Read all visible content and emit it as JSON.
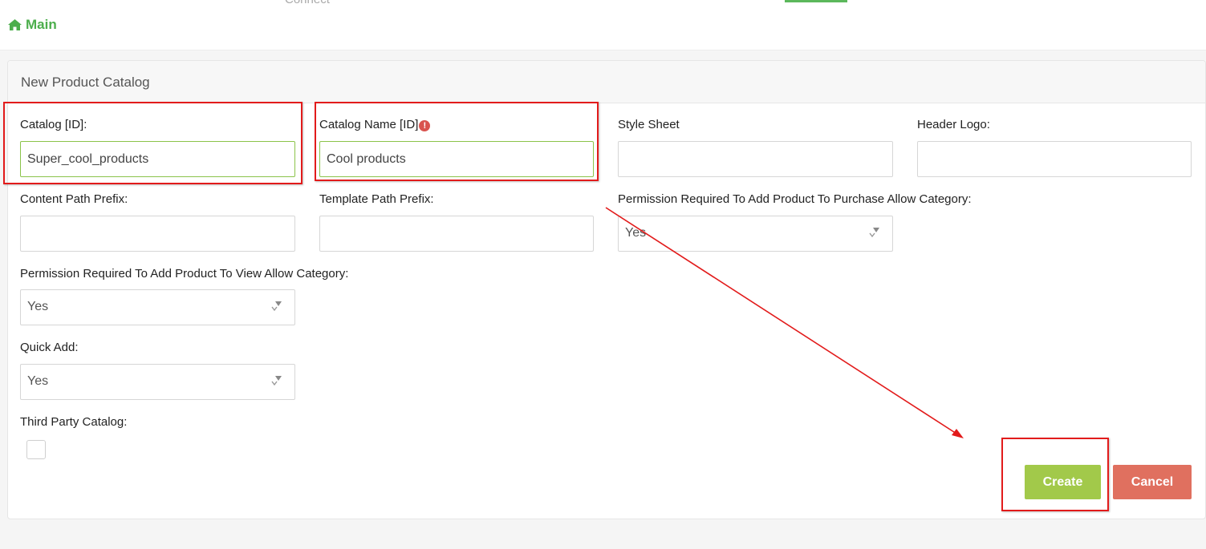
{
  "topnav": {
    "cut_tab_label": "Connect"
  },
  "breadcrumb": {
    "label": "Main"
  },
  "panel": {
    "title": "New Product Catalog"
  },
  "form": {
    "catalog_id": {
      "label": "Catalog [ID]:",
      "value": "Super_cool_products"
    },
    "catalog_name": {
      "label": "Catalog Name [ID]",
      "value": "Cool products",
      "error_glyph": "!"
    },
    "style_sheet": {
      "label": "Style Sheet",
      "value": ""
    },
    "header_logo": {
      "label": "Header Logo:",
      "value": ""
    },
    "content_path_prefix": {
      "label": "Content Path Prefix:",
      "value": ""
    },
    "template_path_prefix": {
      "label": "Template Path Prefix:",
      "value": ""
    },
    "perm_purchase": {
      "label": "Permission Required To Add Product To Purchase Allow Category:",
      "value": "Yes"
    },
    "perm_view": {
      "label": "Permission Required To Add Product To View Allow Category:",
      "value": "Yes"
    },
    "quick_add": {
      "label": "Quick Add:",
      "value": "Yes"
    },
    "third_party": {
      "label": "Third Party Catalog:",
      "checked": false
    }
  },
  "buttons": {
    "create_label": "Create",
    "cancel_label": "Cancel"
  },
  "colors": {
    "accent_green": "#4cae4c",
    "create_button": "#a2c94a",
    "cancel_button": "#e0705f",
    "annotation_red": "#e21b1b",
    "error_red": "#d9534f"
  },
  "icons": {
    "breadcrumb": "home-icon",
    "select_arrow": "sort-arrow-icon",
    "error": "exclamation-circle-icon"
  }
}
